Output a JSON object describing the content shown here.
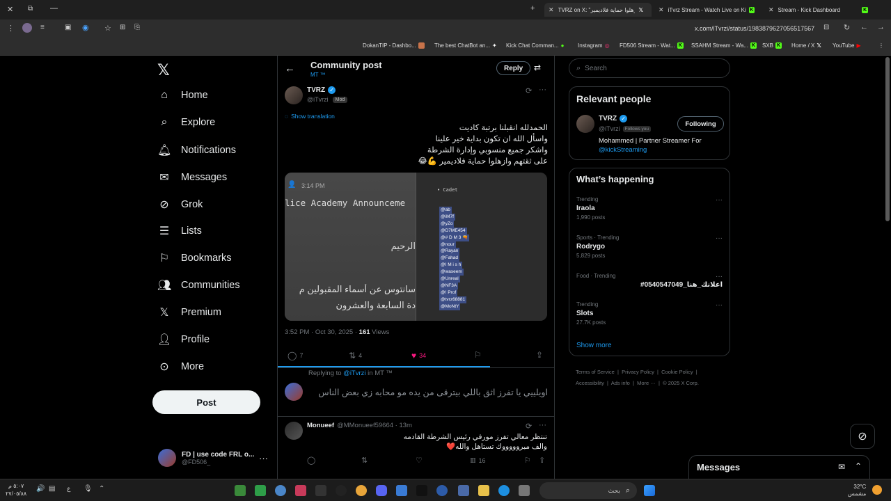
{
  "browser": {
    "tabs": [
      {
        "title": "TVRZ on X: \"زهلوا حماية فلاديمير\"",
        "active": true
      },
      {
        "title": "iTvrz Stream - Watch Live on Ki"
      },
      {
        "title": "Stream - Kick Dashboard"
      }
    ],
    "url": "x.com/iTvrzi/status/1983879627056517567",
    "bookmarks": [
      "DokanTIP - Dashbo...",
      "The best ChatBot an...",
      "Kick Chat Comman...",
      "Instagram",
      "FD506 Stream - Wat...",
      "SSAHM Stream - Wa...",
      "SXB",
      "Home / X",
      "YouTube"
    ]
  },
  "nav": {
    "items": [
      {
        "label": "Home",
        "icon": "home-icon"
      },
      {
        "label": "Explore",
        "icon": "search-icon"
      },
      {
        "label": "Notifications",
        "icon": "bell-icon"
      },
      {
        "label": "Messages",
        "icon": "envelope-icon"
      },
      {
        "label": "Grok",
        "icon": "grok-icon"
      },
      {
        "label": "Lists",
        "icon": "list-icon"
      },
      {
        "label": "Bookmarks",
        "icon": "bookmark-icon"
      },
      {
        "label": "Communities",
        "icon": "communities-icon"
      },
      {
        "label": "Premium",
        "icon": "x-logo-icon"
      },
      {
        "label": "Profile",
        "icon": "person-icon"
      },
      {
        "label": "More",
        "icon": "more-circle-icon"
      }
    ],
    "post_label": "Post",
    "account": {
      "name": "FD | use code FRL o...",
      "handle": "@FD506_"
    }
  },
  "header": {
    "title": "Community post",
    "subtitle": "MT ™",
    "reply_label": "Reply"
  },
  "post": {
    "author": "TVRZ",
    "handle": "@iTvrzi",
    "badge": "Mod",
    "translate": "Show translation",
    "lines": [
      "الحمدلله انقبلنا برتبة كاديت",
      "واسأل الله ان تكون بداية خير علينا",
      "واشكر جميع منسوبي وإدارة الشرطة",
      "على ثقتهم وازهلوا حماية فلاديمير 💪😂"
    ],
    "image": {
      "time": "3:14 PM",
      "announcement": "lice Academy Announceme",
      "arabic_1": "الرحيم",
      "arabic_2": "سانتوس عن أسماء المقبولين م",
      "arabic_3": "دة السابعة والعشرون",
      "cadet": "• Cadet",
      "names": [
        "@ab",
        "@iM7f",
        "@yZo",
        "@D7ME454",
        "@# D M 3 🔫",
        "@nour",
        "@Rayan",
        "@Fahad",
        "@I M i s h",
        "@waseem",
        "@Unreal",
        "@NF3A",
        "@! Prof",
        "@tvrz68881",
        "@MoNtY"
      ]
    },
    "meta_time": "3:52 PM · Oct 30, 2025 · ",
    "views": "161",
    "views_label": " Views",
    "stats": {
      "replies": "7",
      "reposts": "4",
      "likes": "34"
    }
  },
  "reply_box": {
    "replying_prefix": "Replying to ",
    "replying_to": "@iTvrzi",
    "replying_suffix": " in MT ™",
    "text": "اويلييي يا تفرز اثق باللي بيترقى من يده مو محابه زي بعض الناس"
  },
  "reply": {
    "author": "Monueef",
    "handle": "@MMonueef59664 · 13m",
    "lines": [
      "تنتظر معالي تفرز مورفي رئيس الشرطة القادمه",
      "والف مبروووووك تستاهل والله❤️"
    ],
    "views": "16"
  },
  "search": {
    "placeholder": "Search"
  },
  "relevant": {
    "title": "Relevant people",
    "name": "TVRZ",
    "handle": "@iTvrzi",
    "follows_you": "Follows you",
    "following_label": "Following",
    "bio": "Mohammed | Partner Streamer For ",
    "bio_link": "@kickStreaming"
  },
  "trends": {
    "title": "What’s happening",
    "items": [
      {
        "category": "Trending",
        "name": "Iraola",
        "count": "1,990 posts"
      },
      {
        "category": "Sports · Trending",
        "name": "Rodrygo",
        "count": "5,829 posts"
      },
      {
        "category": "Food · Trending",
        "name": "#اعلانك_هنا_0540547049",
        "count": ""
      },
      {
        "category": "Trending",
        "name": "Slots",
        "count": "27.7K posts"
      }
    ],
    "show_more": "Show more"
  },
  "footer": {
    "links": [
      "Terms of Service",
      "Privacy Policy",
      "Cookie Policy",
      "Accessibility",
      "Ads info",
      "More ···",
      "© 2025 X Corp."
    ]
  },
  "messages_dock": {
    "label": "Messages"
  },
  "taskbar": {
    "clock_time": "٥:٠٧ م",
    "clock_date": "٢٧/٠٥/٨٨",
    "search_placeholder": "بحث",
    "weather_temp": "32°C",
    "weather_desc": "مشمس"
  }
}
